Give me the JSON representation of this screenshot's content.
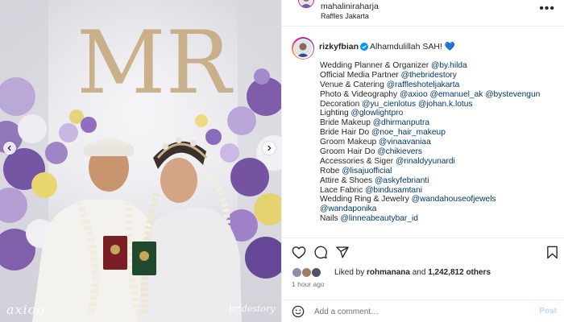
{
  "post": {
    "author": "mahaliniraharja",
    "location": "Raffles Jakarta"
  },
  "photo": {
    "monogram": "MR",
    "watermark_left": "axioo",
    "watermark_right": "bridestory"
  },
  "caption": {
    "username": "rizkyfbian",
    "text": "Alhamdulillah SAH!",
    "heart": "💙",
    "lines": [
      {
        "label": "Wedding Planner & Organizer ",
        "mentions": [
          "@by.hilda"
        ]
      },
      {
        "label": "Official Media Partner ",
        "mentions": [
          "@thebridestory"
        ]
      },
      {
        "label": "Venue & Catering ",
        "mentions": [
          "@raffleshoteljakarta"
        ]
      },
      {
        "label": "Photo & Videography ",
        "mentions": [
          "@axioo",
          "@emanuel_ak",
          "@bystevengun"
        ]
      },
      {
        "label": "Decoration ",
        "mentions": [
          "@yu_cienlotus",
          "@johan.k.lotus"
        ]
      },
      {
        "label": "Lighting ",
        "mentions": [
          "@glowlightpro"
        ]
      },
      {
        "label": "Bride Makeup ",
        "mentions": [
          "@dhirmanputra"
        ]
      },
      {
        "label": "Bride Hair Do ",
        "mentions": [
          "@noe_hair_makeup"
        ]
      },
      {
        "label": "Groom Makeup ",
        "mentions": [
          "@vinaavaniaa"
        ]
      },
      {
        "label": "Groom Hair Do ",
        "mentions": [
          "@chikievers"
        ]
      },
      {
        "label": "Accessories & Siger ",
        "mentions": [
          "@rinaldyyunardi"
        ]
      },
      {
        "label": "Robe ",
        "mentions": [
          "@lisajuofficial"
        ]
      },
      {
        "label": "Attire & Shoes ",
        "mentions": [
          "@askyfebrianti"
        ]
      },
      {
        "label": "Lace Fabric ",
        "mentions": [
          "@bindusamtani"
        ]
      },
      {
        "label": "Wedding Ring & Jewelry ",
        "mentions": [
          "@wandahouseofjewels"
        ]
      },
      {
        "label": "",
        "mentions": [
          "@wandaponika"
        ]
      },
      {
        "label": "Nails ",
        "mentions": [
          "@linneabeautybar_id"
        ]
      }
    ]
  },
  "likes": {
    "prefix": "Liked by ",
    "user": "rohmanana",
    "middle": " and ",
    "count": "1,242,812 others"
  },
  "timestamp": "1 hour ago",
  "comment_box": {
    "placeholder": "Add a comment…",
    "post_label": "Post"
  },
  "icons": {
    "verified": "verified-badge-icon",
    "more": "more-options-icon",
    "like": "heart-icon",
    "comment": "comment-icon",
    "share": "share-icon",
    "save": "bookmark-icon",
    "emoji": "emoji-icon",
    "prev": "chevron-left-icon",
    "next": "chevron-right-icon"
  },
  "colors": {
    "mention": "#00376b",
    "verified": "#0095f6",
    "post_disabled": "#b2dffc",
    "muted": "#737373"
  }
}
